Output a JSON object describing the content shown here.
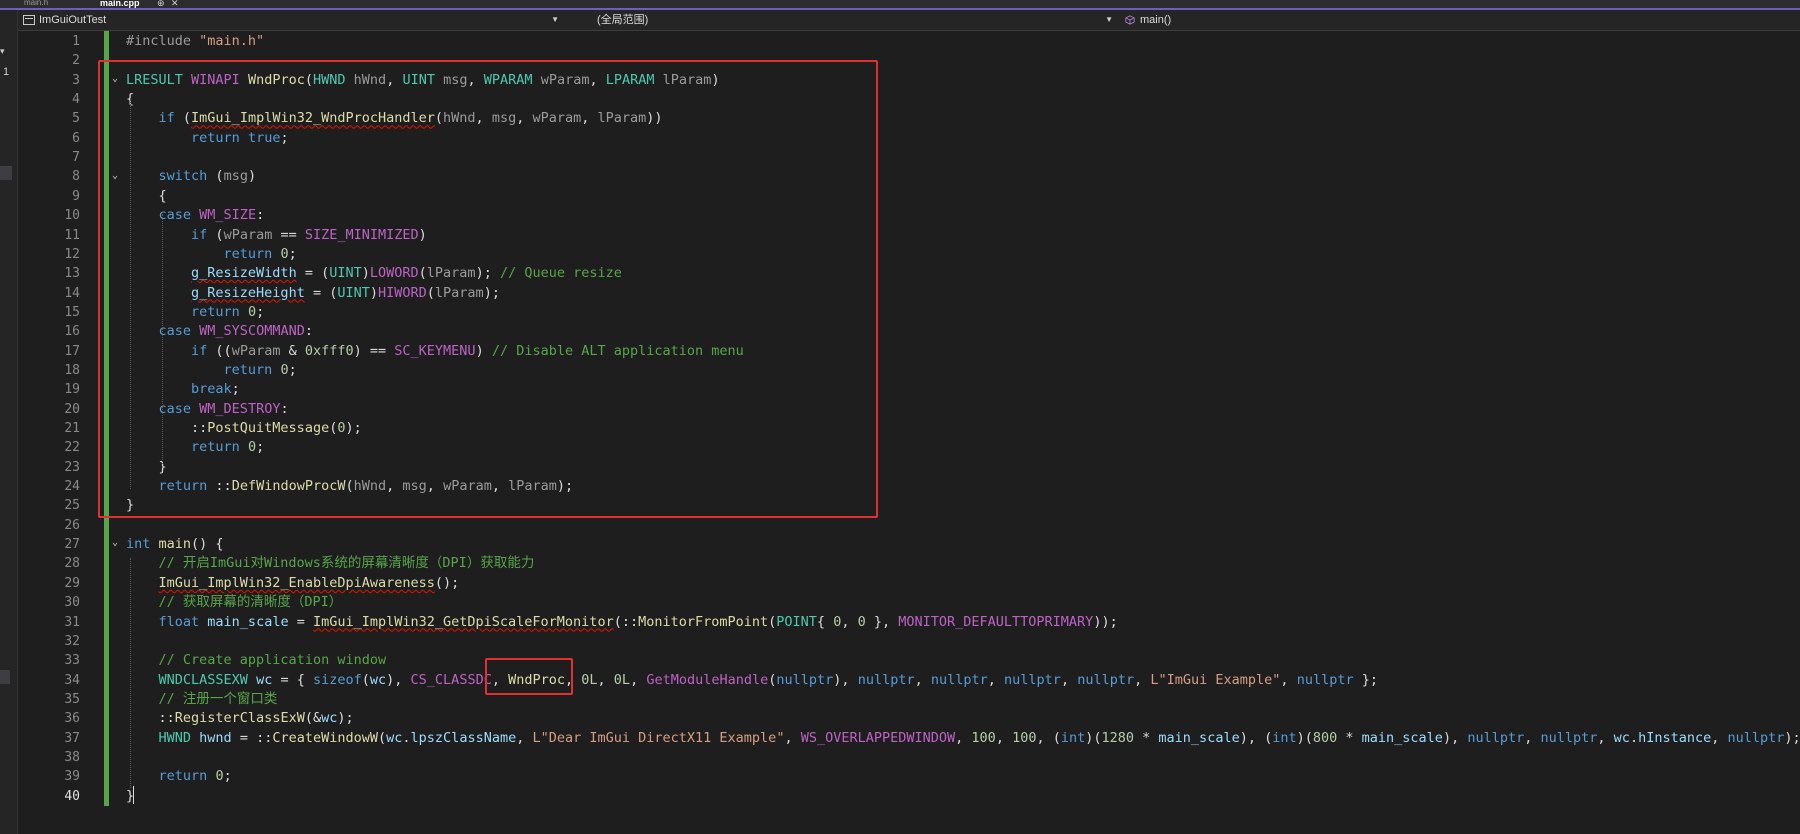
{
  "tabs": {
    "inactive_label": "main.h",
    "active_label": "main.cpp",
    "pin_glyph": "⊕",
    "close_glyph": "✕"
  },
  "navigation": {
    "project": "ImGuiOutTest",
    "scope": "(全局范围)",
    "member": "main()"
  },
  "colors": {
    "accent": "#6d5fbf",
    "change_bar": "#57a64a",
    "highlight_box": "#e03030"
  },
  "icons": {
    "project": "cpp-project-icon",
    "member": "function-cube-icon"
  },
  "editor": {
    "current_line": 40,
    "line_numbers": [
      "1",
      "2",
      "3",
      "4",
      "5",
      "6",
      "7",
      "8",
      "9",
      "10",
      "11",
      "12",
      "13",
      "14",
      "15",
      "16",
      "17",
      "18",
      "19",
      "20",
      "21",
      "22",
      "23",
      "24",
      "25",
      "26",
      "27",
      "28",
      "29",
      "30",
      "31",
      "32",
      "33",
      "34",
      "35",
      "36",
      "37",
      "38",
      "39",
      "40"
    ],
    "lines": [
      [
        [
          "pp",
          "#include "
        ],
        [
          "str",
          "\"main.h\""
        ]
      ],
      [],
      [
        [
          "ty",
          "LRESULT"
        ],
        [
          "plain",
          " "
        ],
        [
          "mac",
          "WINAPI"
        ],
        [
          "plain",
          " "
        ],
        [
          "fn",
          "WndProc"
        ],
        [
          "plain",
          "("
        ],
        [
          "ty",
          "HWND"
        ],
        [
          "plain",
          " "
        ],
        [
          "pp",
          "hWnd"
        ],
        [
          "plain",
          ", "
        ],
        [
          "ty",
          "UINT"
        ],
        [
          "plain",
          " "
        ],
        [
          "pp",
          "msg"
        ],
        [
          "plain",
          ", "
        ],
        [
          "ty",
          "WPARAM"
        ],
        [
          "plain",
          " "
        ],
        [
          "pp",
          "wParam"
        ],
        [
          "plain",
          ", "
        ],
        [
          "ty",
          "LPARAM"
        ],
        [
          "plain",
          " "
        ],
        [
          "pp",
          "lParam"
        ],
        [
          "plain",
          ")"
        ]
      ],
      [
        [
          "plain",
          "{"
        ]
      ],
      [
        [
          "plain",
          "    "
        ],
        [
          "kw",
          "if"
        ],
        [
          "plain",
          " ("
        ],
        [
          "fn squig",
          "ImGui_ImplWin32_WndProcHandler"
        ],
        [
          "plain",
          "("
        ],
        [
          "pp",
          "hWnd"
        ],
        [
          "plain",
          ", "
        ],
        [
          "pp",
          "msg"
        ],
        [
          "plain",
          ", "
        ],
        [
          "pp",
          "wParam"
        ],
        [
          "plain",
          ", "
        ],
        [
          "pp",
          "lParam"
        ],
        [
          "plain",
          "))"
        ]
      ],
      [
        [
          "plain",
          "        "
        ],
        [
          "kw",
          "return"
        ],
        [
          "plain",
          " "
        ],
        [
          "kw",
          "true"
        ],
        [
          "plain",
          ";"
        ]
      ],
      [],
      [
        [
          "plain",
          "    "
        ],
        [
          "kw",
          "switch"
        ],
        [
          "plain",
          " ("
        ],
        [
          "pp",
          "msg"
        ],
        [
          "plain",
          ")"
        ]
      ],
      [
        [
          "plain",
          "    {"
        ]
      ],
      [
        [
          "plain",
          "    "
        ],
        [
          "kw",
          "case"
        ],
        [
          "plain",
          " "
        ],
        [
          "mac",
          "WM_SIZE"
        ],
        [
          "plain",
          ":"
        ]
      ],
      [
        [
          "plain",
          "        "
        ],
        [
          "kw",
          "if"
        ],
        [
          "plain",
          " ("
        ],
        [
          "pp",
          "wParam"
        ],
        [
          "plain",
          " == "
        ],
        [
          "mac",
          "SIZE_MINIMIZED"
        ],
        [
          "plain",
          ")"
        ]
      ],
      [
        [
          "plain",
          "            "
        ],
        [
          "kw",
          "return"
        ],
        [
          "plain",
          " "
        ],
        [
          "num",
          "0"
        ],
        [
          "plain",
          ";"
        ]
      ],
      [
        [
          "plain",
          "        "
        ],
        [
          "var squig",
          "g_ResizeWidth"
        ],
        [
          "plain",
          " = ("
        ],
        [
          "ty",
          "UINT"
        ],
        [
          "plain",
          ")"
        ],
        [
          "mac",
          "LOWORD"
        ],
        [
          "plain",
          "("
        ],
        [
          "pp",
          "lParam"
        ],
        [
          "plain",
          "); "
        ],
        [
          "cmt",
          "// Queue resize"
        ]
      ],
      [
        [
          "plain",
          "        "
        ],
        [
          "var squig",
          "g_ResizeHeight"
        ],
        [
          "plain",
          " = ("
        ],
        [
          "ty",
          "UINT"
        ],
        [
          "plain",
          ")"
        ],
        [
          "mac",
          "HIWORD"
        ],
        [
          "plain",
          "("
        ],
        [
          "pp",
          "lParam"
        ],
        [
          "plain",
          ");"
        ]
      ],
      [
        [
          "plain",
          "        "
        ],
        [
          "kw",
          "return"
        ],
        [
          "plain",
          " "
        ],
        [
          "num",
          "0"
        ],
        [
          "plain",
          ";"
        ]
      ],
      [
        [
          "plain",
          "    "
        ],
        [
          "kw",
          "case"
        ],
        [
          "plain",
          " "
        ],
        [
          "mac",
          "WM_SYSCOMMAND"
        ],
        [
          "plain",
          ":"
        ]
      ],
      [
        [
          "plain",
          "        "
        ],
        [
          "kw",
          "if"
        ],
        [
          "plain",
          " (("
        ],
        [
          "pp",
          "wParam"
        ],
        [
          "plain",
          " & "
        ],
        [
          "num",
          "0xfff0"
        ],
        [
          "plain",
          ") == "
        ],
        [
          "mac",
          "SC_KEYMENU"
        ],
        [
          "plain",
          ") "
        ],
        [
          "cmt",
          "// Disable ALT application menu"
        ]
      ],
      [
        [
          "plain",
          "            "
        ],
        [
          "kw",
          "return"
        ],
        [
          "plain",
          " "
        ],
        [
          "num",
          "0"
        ],
        [
          "plain",
          ";"
        ]
      ],
      [
        [
          "plain",
          "        "
        ],
        [
          "kw",
          "break"
        ],
        [
          "plain",
          ";"
        ]
      ],
      [
        [
          "plain",
          "    "
        ],
        [
          "kw",
          "case"
        ],
        [
          "plain",
          " "
        ],
        [
          "mac",
          "WM_DESTROY"
        ],
        [
          "plain",
          ":"
        ]
      ],
      [
        [
          "plain",
          "        ::"
        ],
        [
          "fn",
          "PostQuitMessage"
        ],
        [
          "plain",
          "("
        ],
        [
          "num",
          "0"
        ],
        [
          "plain",
          ");"
        ]
      ],
      [
        [
          "plain",
          "        "
        ],
        [
          "kw",
          "return"
        ],
        [
          "plain",
          " "
        ],
        [
          "num",
          "0"
        ],
        [
          "plain",
          ";"
        ]
      ],
      [
        [
          "plain",
          "    }"
        ]
      ],
      [
        [
          "plain",
          "    "
        ],
        [
          "kw",
          "return"
        ],
        [
          "plain",
          " ::"
        ],
        [
          "fn",
          "DefWindowProcW"
        ],
        [
          "plain",
          "("
        ],
        [
          "pp",
          "hWnd"
        ],
        [
          "plain",
          ", "
        ],
        [
          "pp",
          "msg"
        ],
        [
          "plain",
          ", "
        ],
        [
          "pp",
          "wParam"
        ],
        [
          "plain",
          ", "
        ],
        [
          "pp",
          "lParam"
        ],
        [
          "plain",
          ");"
        ]
      ],
      [
        [
          "plain",
          "}"
        ]
      ],
      [],
      [
        [
          "kw",
          "int"
        ],
        [
          "plain",
          " "
        ],
        [
          "fn",
          "main"
        ],
        [
          "plain",
          "() {"
        ]
      ],
      [
        [
          "plain",
          "    "
        ],
        [
          "cmt",
          "// 开启ImGui对Windows系统的屏幕清晰度（DPI）获取能力"
        ]
      ],
      [
        [
          "plain",
          "    "
        ],
        [
          "fn squig",
          "ImGui_ImplWin32_EnableDpiAwareness"
        ],
        [
          "plain",
          "();"
        ]
      ],
      [
        [
          "plain",
          "    "
        ],
        [
          "cmt",
          "// 获取屏幕的清晰度（DPI）"
        ]
      ],
      [
        [
          "plain",
          "    "
        ],
        [
          "kw",
          "float"
        ],
        [
          "plain",
          " "
        ],
        [
          "var",
          "main_scale"
        ],
        [
          "plain",
          " = "
        ],
        [
          "fn squig",
          "ImGui_ImplWin32_GetDpiScaleForMonitor"
        ],
        [
          "plain",
          "(::"
        ],
        [
          "fn",
          "MonitorFromPoint"
        ],
        [
          "plain",
          "("
        ],
        [
          "ty",
          "POINT"
        ],
        [
          "plain",
          "{ "
        ],
        [
          "num",
          "0"
        ],
        [
          "plain",
          ", "
        ],
        [
          "num",
          "0"
        ],
        [
          "plain",
          " }, "
        ],
        [
          "mac",
          "MONITOR_DEFAULTTOPRIMARY"
        ],
        [
          "plain",
          "));"
        ]
      ],
      [],
      [
        [
          "plain",
          "    "
        ],
        [
          "cmt",
          "// Create application window"
        ]
      ],
      [
        [
          "plain",
          "    "
        ],
        [
          "ty",
          "WNDCLASSEXW"
        ],
        [
          "plain",
          " "
        ],
        [
          "var",
          "wc"
        ],
        [
          "plain",
          " = { "
        ],
        [
          "kw",
          "sizeof"
        ],
        [
          "plain",
          "("
        ],
        [
          "var",
          "wc"
        ],
        [
          "plain",
          "), "
        ],
        [
          "mac",
          "CS_CLASSDC"
        ],
        [
          "plain",
          ", "
        ],
        [
          "fn",
          "WndProc"
        ],
        [
          "plain",
          ", "
        ],
        [
          "num",
          "0L"
        ],
        [
          "plain",
          ", "
        ],
        [
          "num",
          "0L"
        ],
        [
          "plain",
          ", "
        ],
        [
          "mac",
          "GetModuleHandle"
        ],
        [
          "plain",
          "("
        ],
        [
          "kw",
          "nullptr"
        ],
        [
          "plain",
          "), "
        ],
        [
          "kw",
          "nullptr"
        ],
        [
          "plain",
          ", "
        ],
        [
          "kw",
          "nullptr"
        ],
        [
          "plain",
          ", "
        ],
        [
          "kw",
          "nullptr"
        ],
        [
          "plain",
          ", "
        ],
        [
          "kw",
          "nullptr"
        ],
        [
          "plain",
          ", "
        ],
        [
          "str",
          "L\"ImGui Example\""
        ],
        [
          "plain",
          ", "
        ],
        [
          "kw",
          "nullptr"
        ],
        [
          "plain",
          " };"
        ]
      ],
      [
        [
          "plain",
          "    "
        ],
        [
          "cmt",
          "// 注册一个窗口类"
        ]
      ],
      [
        [
          "plain",
          "    ::"
        ],
        [
          "fn",
          "RegisterClassExW"
        ],
        [
          "plain",
          "(&"
        ],
        [
          "var",
          "wc"
        ],
        [
          "plain",
          ");"
        ]
      ],
      [
        [
          "plain",
          "    "
        ],
        [
          "ty",
          "HWND"
        ],
        [
          "plain",
          " "
        ],
        [
          "var",
          "hwnd"
        ],
        [
          "plain",
          " = ::"
        ],
        [
          "fn",
          "CreateWindowW"
        ],
        [
          "plain",
          "("
        ],
        [
          "var",
          "wc"
        ],
        [
          "plain",
          "."
        ],
        [
          "var",
          "lpszClassName"
        ],
        [
          "plain",
          ", "
        ],
        [
          "str",
          "L\"Dear ImGui DirectX11 Example\""
        ],
        [
          "plain",
          ", "
        ],
        [
          "mac",
          "WS_OVERLAPPEDWINDOW"
        ],
        [
          "plain",
          ", "
        ],
        [
          "num",
          "100"
        ],
        [
          "plain",
          ", "
        ],
        [
          "num",
          "100"
        ],
        [
          "plain",
          ", ("
        ],
        [
          "kw",
          "int"
        ],
        [
          "plain",
          ")("
        ],
        [
          "num",
          "1280"
        ],
        [
          "plain",
          " * "
        ],
        [
          "var",
          "main_scale"
        ],
        [
          "plain",
          "), ("
        ],
        [
          "kw",
          "int"
        ],
        [
          "plain",
          ")("
        ],
        [
          "num",
          "800"
        ],
        [
          "plain",
          " * "
        ],
        [
          "var",
          "main_scale"
        ],
        [
          "plain",
          "), "
        ],
        [
          "kw",
          "nullptr"
        ],
        [
          "plain",
          ", "
        ],
        [
          "kw",
          "nullptr"
        ],
        [
          "plain",
          ", "
        ],
        [
          "var",
          "wc"
        ],
        [
          "plain",
          "."
        ],
        [
          "var",
          "hInstance"
        ],
        [
          "plain",
          ", "
        ],
        [
          "kw",
          "nullptr"
        ],
        [
          "plain",
          ");"
        ]
      ],
      [],
      [
        [
          "plain",
          "    "
        ],
        [
          "kw",
          "return"
        ],
        [
          "plain",
          " "
        ],
        [
          "num",
          "0"
        ],
        [
          "plain",
          ";"
        ]
      ],
      [
        [
          "plain",
          "}"
        ]
      ]
    ]
  }
}
